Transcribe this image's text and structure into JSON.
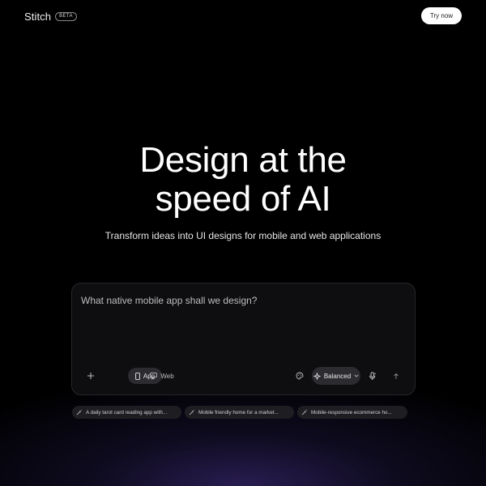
{
  "header": {
    "logo_text": "Stitch",
    "badge": "BETA",
    "cta_label": "Try now"
  },
  "hero": {
    "title_line1": "Design at the",
    "title_line2": "speed of AI",
    "subtitle": "Transform ideas into UI designs for mobile and web applications"
  },
  "prompt": {
    "placeholder": "What native mobile app shall we design?",
    "value": "",
    "toolbar": {
      "add_icon": "plus-icon",
      "app_label": "App",
      "app_icon": "phone-icon",
      "web_label": "Web",
      "web_icon": "monitor-icon",
      "palette_icon": "palette-icon",
      "model_label": "Balanced",
      "model_icon": "sparkle-icon",
      "mic_icon": "microphone-icon",
      "send_icon": "arrow-up-icon"
    }
  },
  "suggestions": [
    {
      "label": "A daily tarot card reading app with...",
      "icon": "magic-wand-icon"
    },
    {
      "label": "Mobile friendly home for a market...",
      "icon": "magic-wand-icon"
    },
    {
      "label": "Mobile-responsive ecommerce ho...",
      "icon": "magic-wand-icon"
    }
  ],
  "colors": {
    "background": "#000000",
    "card": "#0e0e10",
    "pill": "#2c2c30",
    "chip": "#1e1e22",
    "glow": "#302260"
  }
}
